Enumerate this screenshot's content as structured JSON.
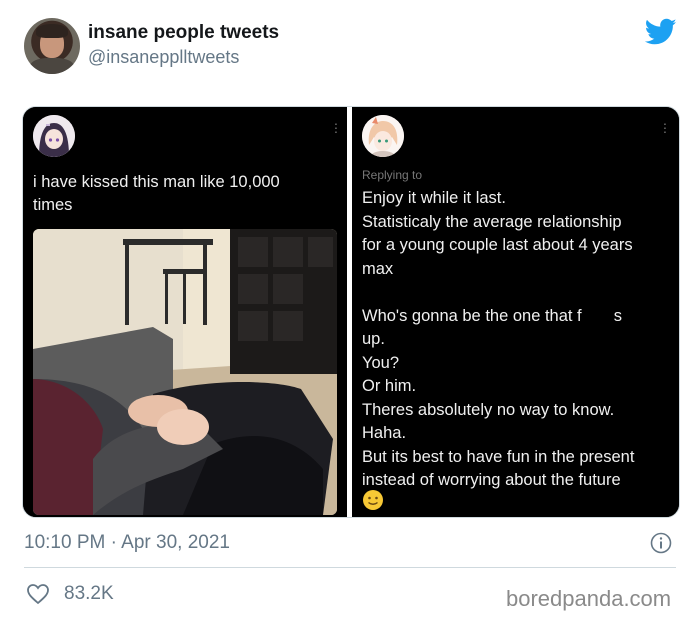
{
  "tweet": {
    "display_name": "insane people tweets",
    "handle": "@insanepplltweets",
    "timestamp": "10:10 PM · Apr 30, 2021",
    "likes": "83.2K",
    "brand_color": "#1da1f2"
  },
  "left_post": {
    "text_lines": [
      "i have kissed this man like 10,000",
      "times"
    ]
  },
  "right_post": {
    "replying_to": "Replying to",
    "lines": [
      "Enjoy it while it last.",
      "Statisticaly the average relationship",
      "for a young couple last about 4 years",
      "max",
      "",
      "Who's gonna be the one that f       s",
      "up.",
      "You?",
      "Or him.",
      "Theres absolutely no way to know.",
      "Haha.",
      "But its best to have fun in the present",
      "instead of worrying about the future"
    ]
  },
  "icons": {
    "twitter": "twitter-bird-icon",
    "info": "info-icon",
    "heart": "heart-icon",
    "emoji": "smile-emoji-icon",
    "menu": "vertical-dots-icon"
  },
  "watermark": "boredpanda.com"
}
